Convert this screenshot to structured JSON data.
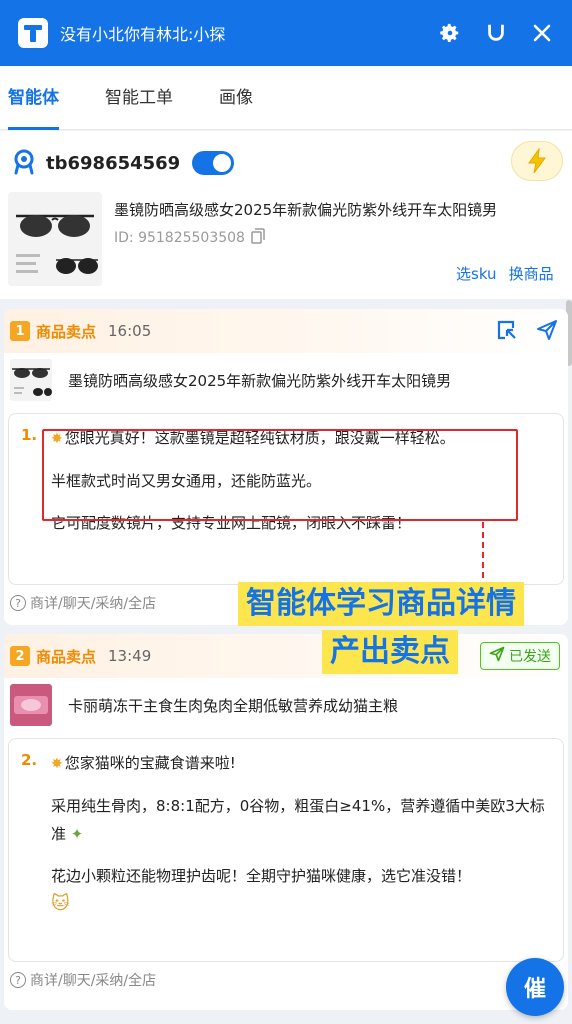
{
  "window": {
    "title": "没有小北你有林北:小探"
  },
  "tabs": [
    {
      "label": "智能体",
      "active": true
    },
    {
      "label": "智能工单",
      "active": false
    },
    {
      "label": "画像",
      "active": false
    }
  ],
  "account": {
    "name": "tb698654569",
    "toggle_on": true
  },
  "product": {
    "title": "墨镜防晒高级感女2025年新款偏光防紫外线开车太阳镜男",
    "id_label": "ID: 951825503508",
    "select_sku": "选sku",
    "change_product": "换商品"
  },
  "cards": [
    {
      "index": "1",
      "title": "商品卖点",
      "time": "16:05",
      "product_title": "墨镜防晒高级感女2025年新款偏光防紫外线开车太阳镜男",
      "list_index": "1.",
      "paragraphs": [
        "您眼光真好！这款墨镜是超轻纯钛材质，跟没戴一样轻松。",
        "半框款式时尚又男女通用，还能防蓝光。",
        "它可配度数镜片，支持专业网上配镜，闭眼入不踩雷！"
      ],
      "footer": "商详/聊天/采纳/全店"
    },
    {
      "index": "2",
      "title": "商品卖点",
      "time": "13:49",
      "sent_label": "已发送",
      "product_title": "卡丽萌冻干主食生肉兔肉全期低敏营养成幼猫主粮",
      "list_index": "2.",
      "paragraphs": [
        "您家猫咪的宝藏食谱来啦!",
        "采用纯生骨肉，8:8:1配方，0谷物，粗蛋白≥41%，营养遵循中美欧3大标准",
        "花边小颗粒还能物理护齿呢！全期守护猫咪健康，选它准没错！"
      ],
      "footer": "商详/聊天/采纳/全店"
    }
  ],
  "annotation": {
    "line1": "智能体学习商品详情",
    "line2": "产出卖点"
  },
  "urge_button": "催",
  "colors": {
    "primary": "#1473e6",
    "accent": "#f08a00",
    "highlight": "#fde64d",
    "alert": "#e0282e",
    "success": "#52c41a"
  }
}
